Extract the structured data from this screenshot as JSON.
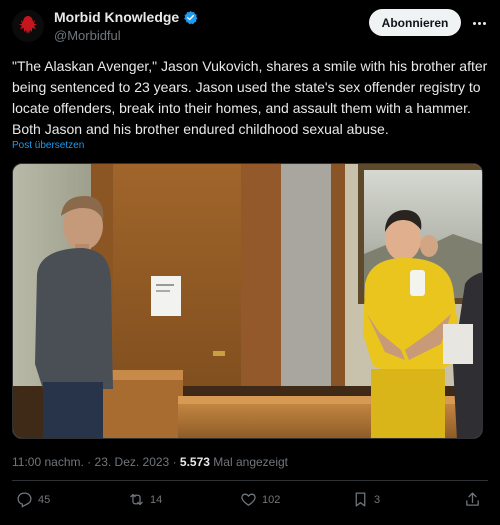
{
  "author": {
    "name": "Morbid Knowledge",
    "handle": "@Morbidful"
  },
  "follow_label": "Abonnieren",
  "tweet": {
    "text": "\"The Alaskan Avenger,\" Jason Vukovich, shares a smile with his brother after being sentenced to 23 years. Jason used the state's sex offender registry to locate offenders, break into their homes, and assault them with a hammer. Both Jason and his brother endured childhood sexual abuse.",
    "translate_label": "Post übersetzen"
  },
  "meta": {
    "time": "11:00 nachm.",
    "separator": "·",
    "date": "23. Dez. 2023",
    "views_count": "5.573",
    "views_label": "Mal angezeigt"
  },
  "actions": {
    "replies": "45",
    "reposts": "14",
    "likes": "102",
    "bookmarks": "3"
  },
  "colors": {
    "background": "#000000",
    "text": "#e7e9ea",
    "muted": "#71767b",
    "link": "#1d9bf0",
    "verified": "#1d9bf0",
    "prison_suit": "#e9c51e"
  },
  "icons": [
    "avatar-logo",
    "verified-badge-icon",
    "more-icon",
    "reply-icon",
    "repost-icon",
    "like-icon",
    "bookmark-icon",
    "share-icon"
  ]
}
